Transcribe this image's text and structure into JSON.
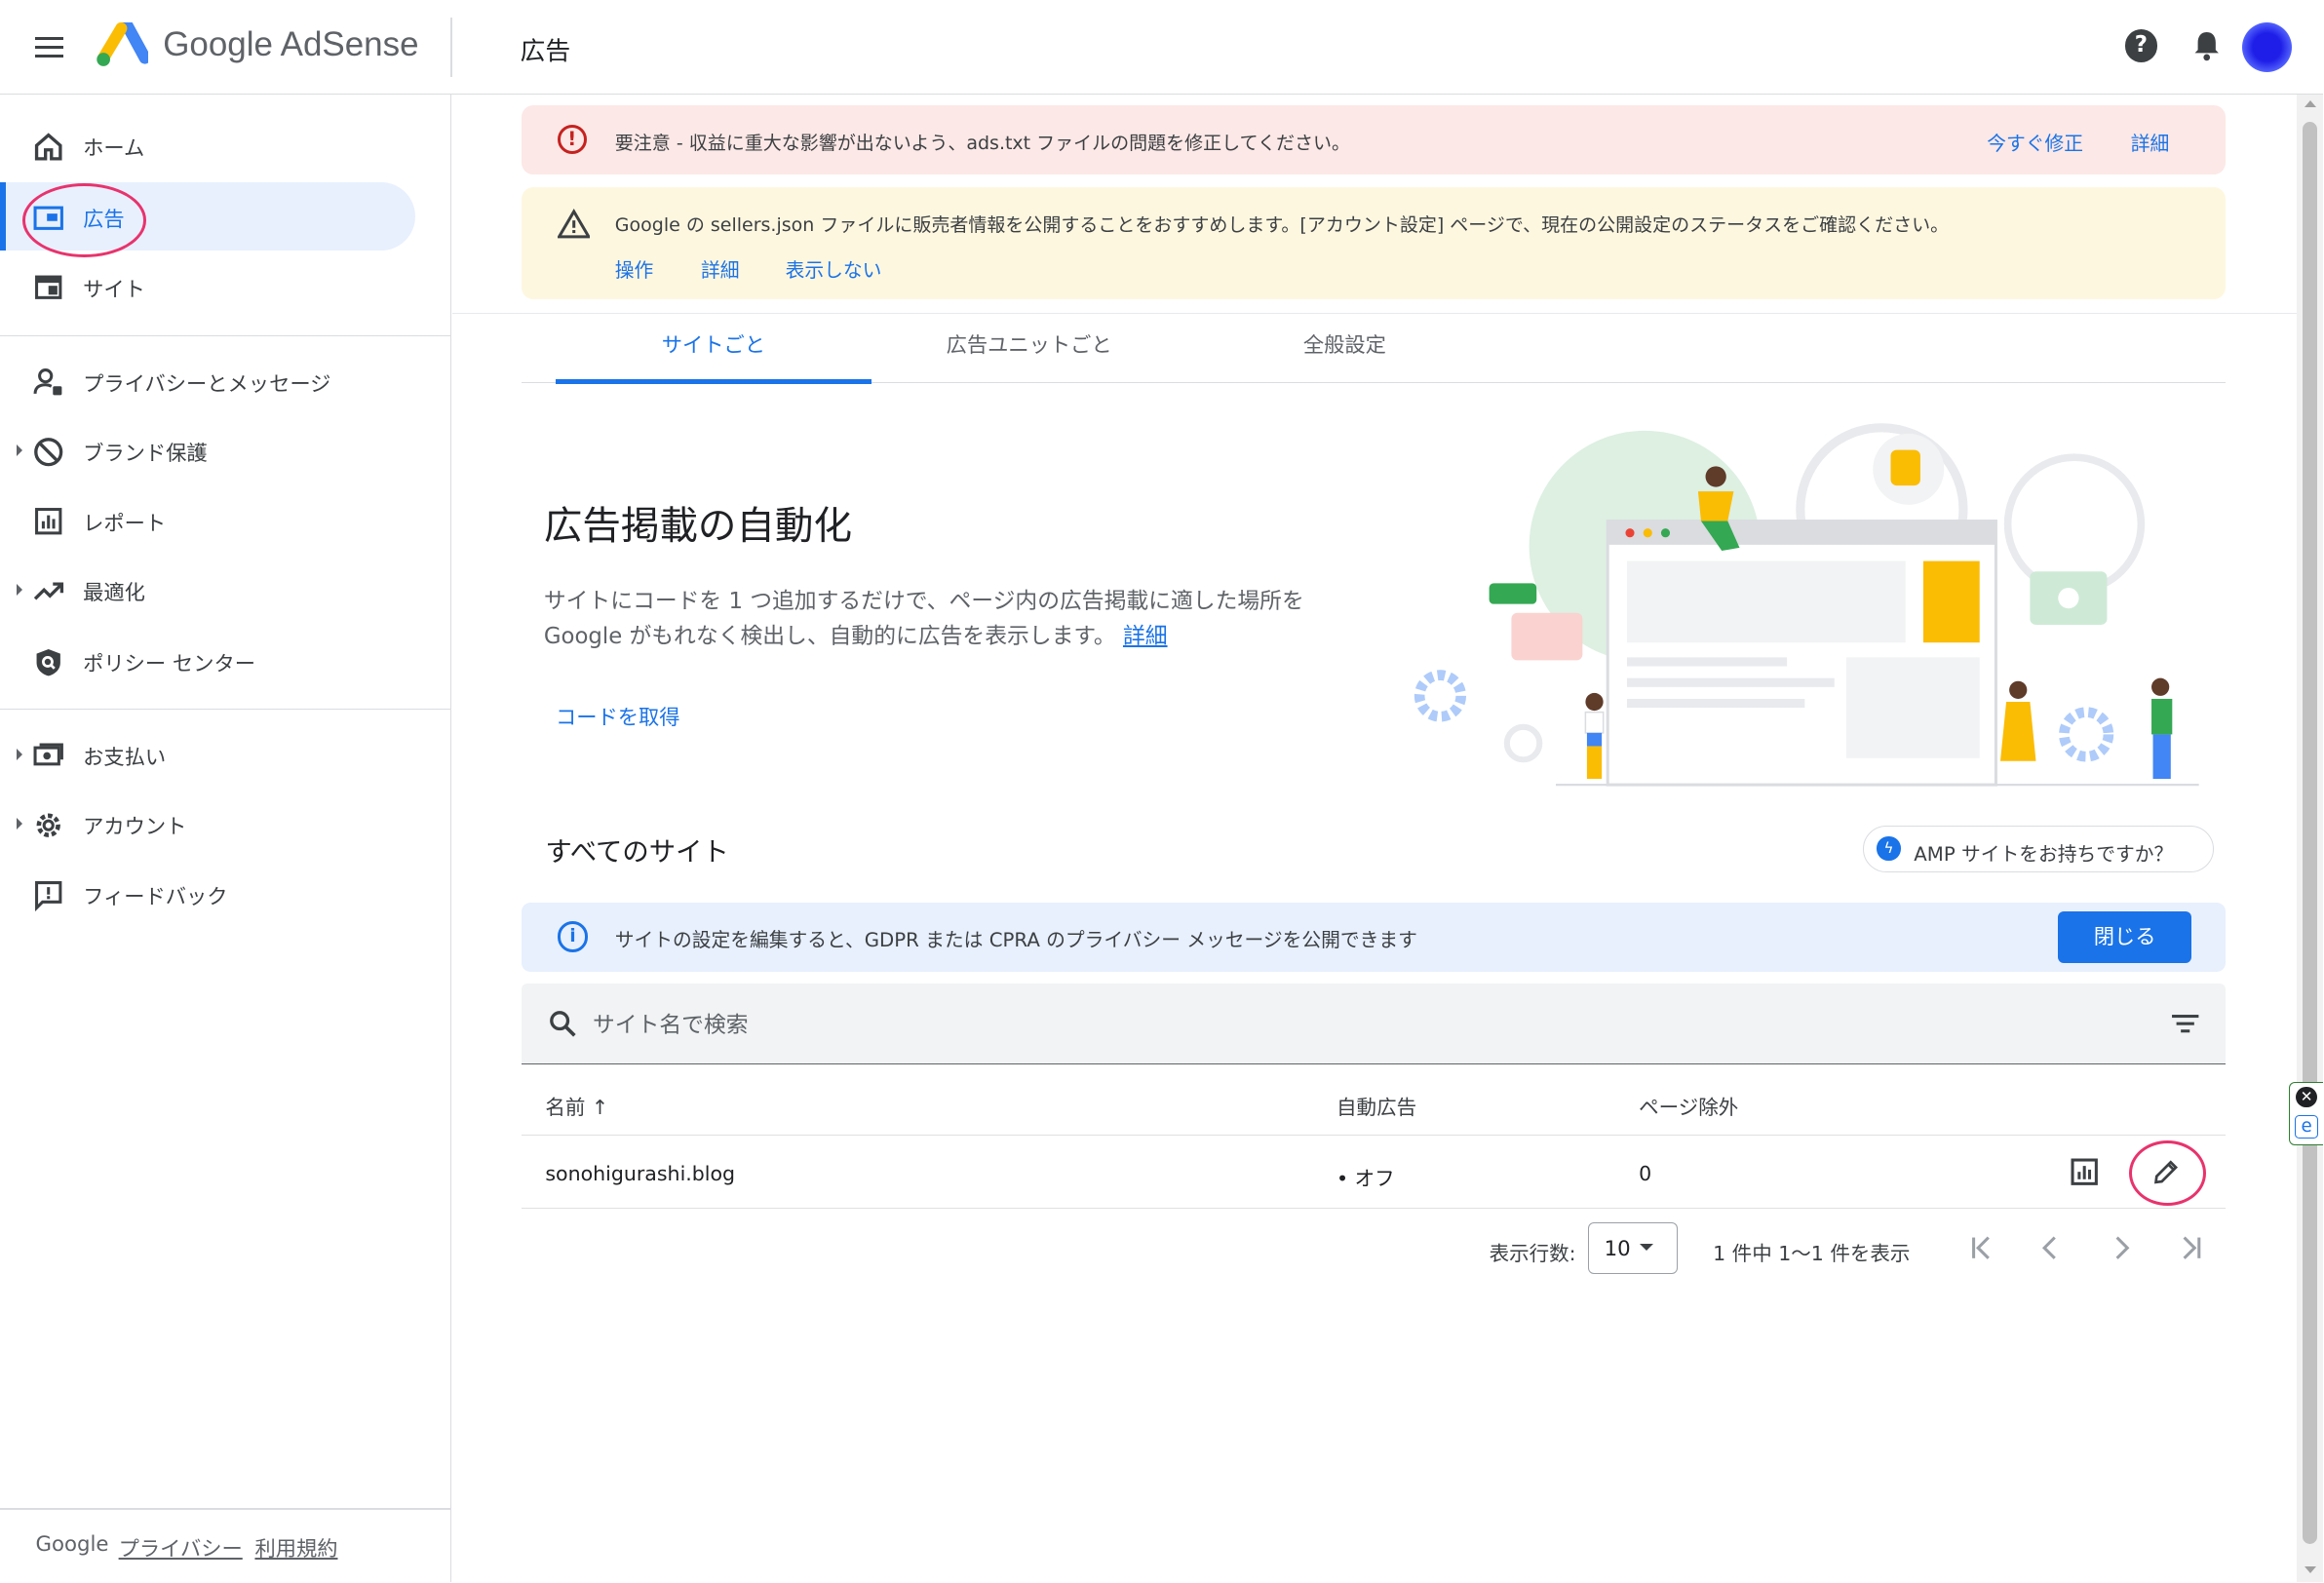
{
  "header": {
    "logo_text": "Google AdSense",
    "page_title": "広告",
    "help_glyph": "?"
  },
  "sidebar": {
    "items": [
      {
        "label": "ホーム",
        "icon": "home-icon"
      },
      {
        "label": "広告",
        "icon": "ads-icon",
        "active": true
      },
      {
        "label": "サイト",
        "icon": "sites-icon"
      },
      {
        "label": "プライバシーとメッセージ",
        "icon": "privacy-icon"
      },
      {
        "label": "ブランド保護",
        "icon": "block-icon",
        "expandable": true
      },
      {
        "label": "レポート",
        "icon": "reports-icon"
      },
      {
        "label": "最適化",
        "icon": "trending-icon",
        "expandable": true
      },
      {
        "label": "ポリシー センター",
        "icon": "policy-icon"
      },
      {
        "label": "お支払い",
        "icon": "payments-icon",
        "expandable": true
      },
      {
        "label": "アカウント",
        "icon": "gear-icon",
        "expandable": true
      },
      {
        "label": "フィードバック",
        "icon": "feedback-icon"
      }
    ],
    "footer": {
      "brand": "Google",
      "privacy": "プライバシー",
      "terms": "利用規約"
    }
  },
  "alerts": {
    "error": {
      "message": "要注意 - 収益に重大な影響が出ないよう、ads.txt ファイルの問題を修正してください。",
      "fix_now": "今すぐ修正",
      "details": "詳細",
      "glyph": "!"
    },
    "warning": {
      "message": "Google の sellers.json ファイルに販売者情報を公開することをおすすめします。[アカウント設定] ページで、現在の公開設定のステータスをご確認ください。",
      "action": "操作",
      "details": "詳細",
      "dismiss": "表示しない"
    }
  },
  "tabs": [
    {
      "label": "サイトごと",
      "active": true
    },
    {
      "label": "広告ユニットごと"
    },
    {
      "label": "全般設定"
    }
  ],
  "hero": {
    "title": "広告掲載の自動化",
    "description": "サイトにコードを 1 つ追加するだけで、ページ内の広告掲載に適した場所を Google がもれなく検出し、自動的に広告を表示します。",
    "details_link": "詳細",
    "get_code": "コードを取得"
  },
  "sites_section": {
    "title": "すべてのサイト",
    "amp_chip": "AMP サイトをお持ちですか？",
    "amp_glyph": "ϟ"
  },
  "info_banner": {
    "message": "サイトの設定を編集すると、GDPR または CPRA のプライバシー メッセージを公開できます",
    "close": "閉じる",
    "glyph": "i"
  },
  "search": {
    "placeholder": "サイト名で検索"
  },
  "table": {
    "columns": [
      "名前 ↑",
      "自動広告",
      "ページ除外"
    ],
    "rows": [
      {
        "name": "sonohigurashi.blog",
        "auto_ads": "• オフ",
        "page_exclusions": "0"
      }
    ]
  },
  "pagination": {
    "rows_label": "表示行数:",
    "rows_value": "10",
    "range": "1 件中 1〜1 件を表示"
  },
  "colors": {
    "accent": "#1a73e8",
    "error_bg": "#fce8e6",
    "warning_bg": "#fef7e0",
    "info_bg": "#e8f0fe",
    "annotation": "#e8336d"
  },
  "extension_widget": {
    "close_glyph": "✕",
    "ext_glyph": "e"
  }
}
